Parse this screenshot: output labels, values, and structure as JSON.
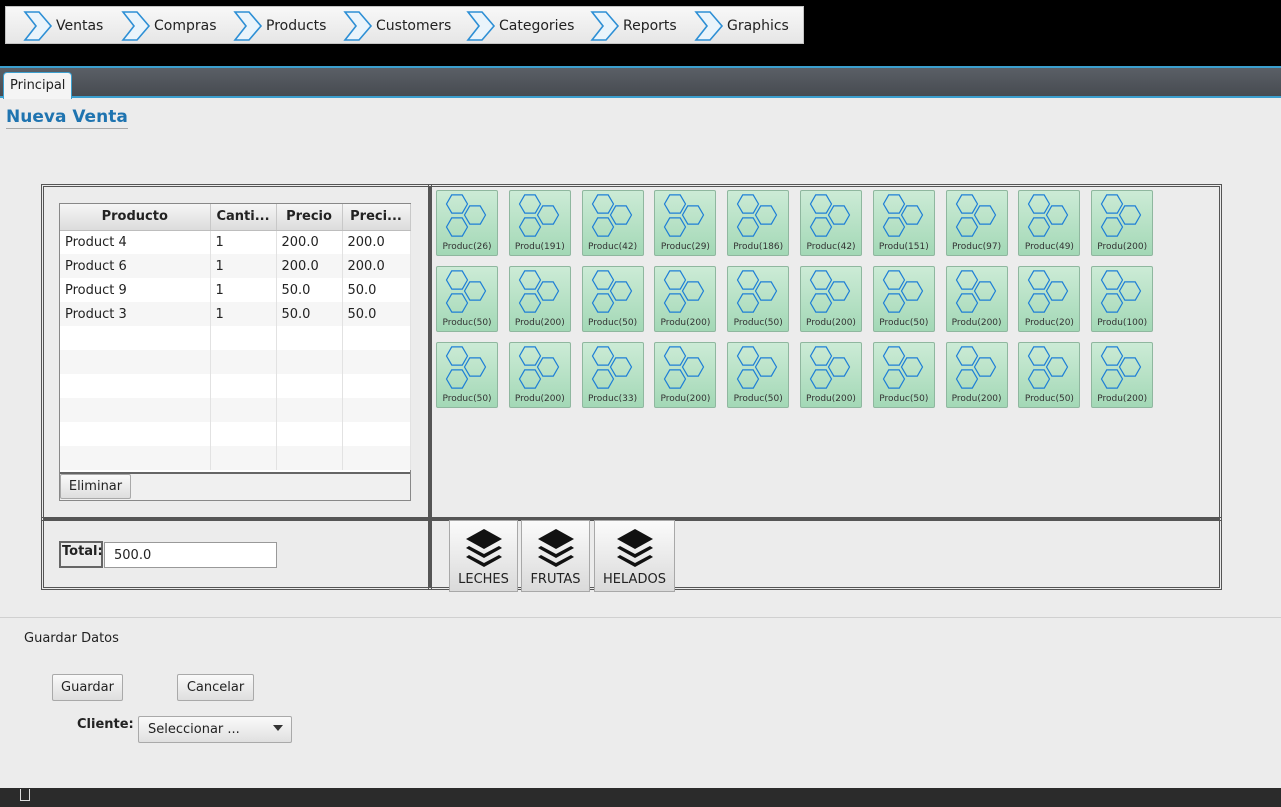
{
  "menu": {
    "items": [
      {
        "label": "Ventas"
      },
      {
        "label": "Compras"
      },
      {
        "label": "Products"
      },
      {
        "label": "Customers"
      },
      {
        "label": "Categories"
      },
      {
        "label": "Reports"
      },
      {
        "label": "Graphics"
      }
    ]
  },
  "tabs": {
    "principal": "Principal"
  },
  "page": {
    "title": "Nueva Venta"
  },
  "table": {
    "headers": [
      "Producto",
      "Canti...",
      "Precio",
      "Preci..."
    ],
    "rows": [
      [
        "Product 4",
        "1",
        "200.0",
        "200.0"
      ],
      [
        "Product 6",
        "1",
        "200.0",
        "200.0"
      ],
      [
        "Product 9",
        "1",
        "50.0",
        "50.0"
      ],
      [
        "Product 3",
        "1",
        "50.0",
        "50.0"
      ],
      [
        "",
        "",
        "",
        ""
      ],
      [
        "",
        "",
        "",
        ""
      ],
      [
        "",
        "",
        "",
        ""
      ],
      [
        "",
        "",
        "",
        ""
      ],
      [
        "",
        "",
        "",
        ""
      ],
      [
        "",
        "",
        "",
        ""
      ]
    ],
    "delete_label": "Eliminar"
  },
  "products": [
    "Produc(26)",
    "Produ(191)",
    "Produc(42)",
    "Produc(29)",
    "Produ(186)",
    "Produc(42)",
    "Produ(151)",
    "Produc(97)",
    "Produc(49)",
    "Produ(200)",
    "Produc(50)",
    "Produ(200)",
    "Produc(50)",
    "Produ(200)",
    "Produc(50)",
    "Produ(200)",
    "Produc(50)",
    "Produ(200)",
    "Produc(20)",
    "Produ(100)",
    "Produc(50)",
    "Produ(200)",
    "Produc(33)",
    "Produ(200)",
    "Produc(50)",
    "Produ(200)",
    "Produc(50)",
    "Produ(200)",
    "Produc(50)",
    "Produ(200)"
  ],
  "categories": [
    {
      "label": "LECHES",
      "icon": "layers-icon"
    },
    {
      "label": "FRUTAS",
      "icon": "layers-icon"
    },
    {
      "label": "HELADOS",
      "icon": "layers-icon"
    }
  ],
  "total": {
    "label": "Total:",
    "value": "500.0"
  },
  "form": {
    "section_label": "Guardar Datos",
    "save_label": "Guardar",
    "cancel_label": "Cancelar",
    "client_label": "Cliente:",
    "client_value": "Seleccionar ..."
  },
  "colors": {
    "accent": "#3b9fcf",
    "title": "#1f74b0",
    "tile_fill": "#b5e1c4",
    "tile_icon": "#1e7fd6"
  }
}
